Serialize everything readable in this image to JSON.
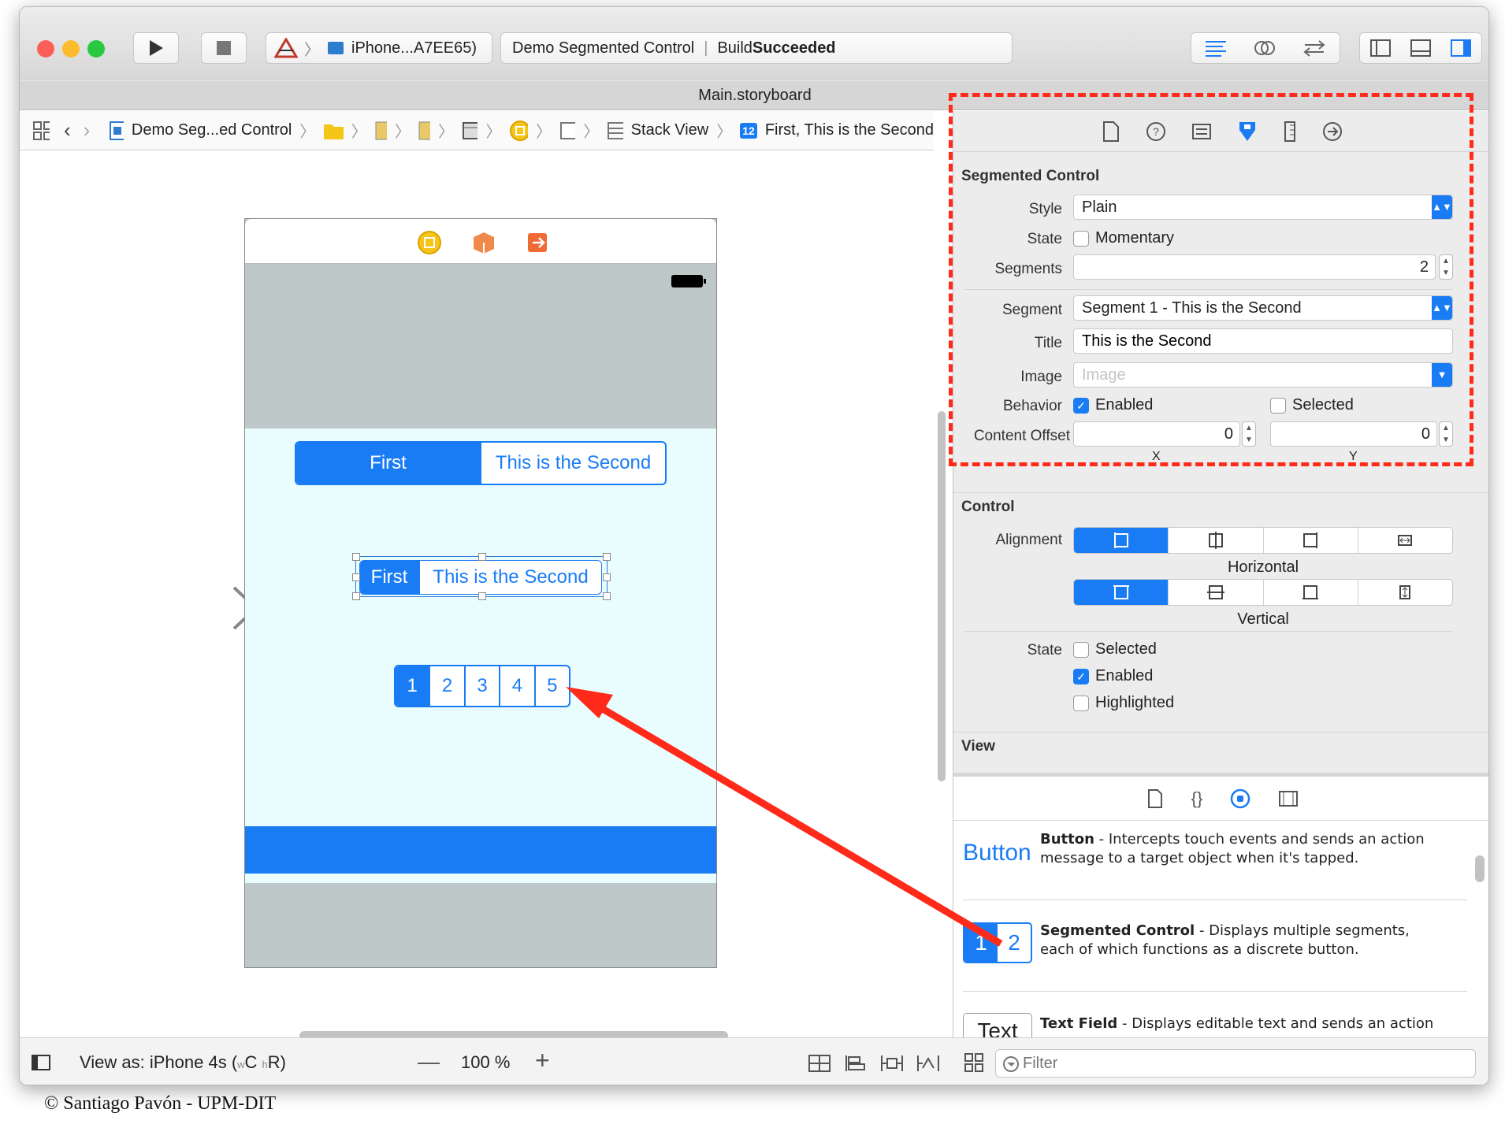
{
  "toolbar": {
    "scheme": "iPhone...A7EE65)",
    "status_project": "Demo Segmented Control",
    "status_build_prefix": "Build ",
    "status_build_result": "Succeeded"
  },
  "tab": {
    "title": "Main.storyboard"
  },
  "jumpbar": {
    "project": "Demo Seg...ed Control",
    "stack_view": "Stack View",
    "selected": "First, This is the Second",
    "selected_badge": "12"
  },
  "canvas": {
    "seg1": [
      "First",
      "This is the Second"
    ],
    "seg2": [
      "First",
      "This is the Second"
    ],
    "seg3": [
      "1",
      "2",
      "3",
      "4",
      "5"
    ]
  },
  "inspector": {
    "seg_section": "Segmented Control",
    "style_label": "Style",
    "style_value": "Plain",
    "state_label": "State",
    "momentary": "Momentary",
    "segments_label": "Segments",
    "segments_value": "2",
    "segment_label": "Segment",
    "segment_value": "Segment 1 - This is the Second",
    "title_label": "Title",
    "title_value": "This is the Second",
    "image_label": "Image",
    "image_placeholder": "Image",
    "behavior_label": "Behavior",
    "enabled": "Enabled",
    "selected": "Selected",
    "offset_label": "Content Offset",
    "offset_x": "0",
    "offset_y": "0",
    "x_label": "X",
    "y_label": "Y",
    "control_section": "Control",
    "alignment_label": "Alignment",
    "horizontal": "Horizontal",
    "vertical": "Vertical",
    "cstate_label": "State",
    "c_selected": "Selected",
    "c_enabled": "Enabled",
    "c_highlighted": "Highlighted",
    "view_section": "View"
  },
  "library": {
    "items": [
      {
        "preview": "Button",
        "name": "Button",
        "desc1": " - Intercepts touch events and sends an action",
        "desc2": "message to a target object when it's tapped."
      },
      {
        "preview_a": "1",
        "preview_b": "2",
        "name": "Segmented Control",
        "desc1": " - Displays multiple segments,",
        "desc2": "each of which functions as a discrete button."
      },
      {
        "preview": "Text",
        "name": "Text Field",
        "desc1": " - Displays editable text and sends an action",
        "desc2": ""
      }
    ],
    "filter_placeholder": "Filter"
  },
  "statusbar": {
    "view_as": "View as: iPhone 4s (",
    "w": "w",
    "c": "C ",
    "h": "h",
    "r": "R)",
    "zoom": "100 %"
  },
  "footer": {
    "copyright": "© Santiago Pavón - UPM-DIT"
  },
  "colors": {
    "accent": "#1a7cf5",
    "annotation": "#ff2a1a",
    "phone_bg": "#bfc8c9",
    "view_bg": "#e9fdfe"
  }
}
